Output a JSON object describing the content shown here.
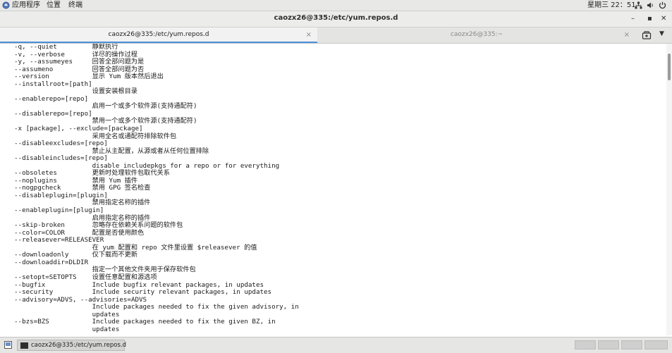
{
  "topbar": {
    "applications": "应用程序",
    "places": "位置",
    "terminal": "终端",
    "datetime": "星期三 22：51"
  },
  "window": {
    "title": "caozx26@335:/etc/yum.repos.d",
    "minimize_glyph": "–",
    "maximize_glyph": "▪",
    "close_glyph": "✕"
  },
  "tabs": [
    {
      "label": "caozx26@335:/etc/yum.repos.d",
      "close": "×",
      "active": true
    },
    {
      "label": "caozx26@335:~",
      "close": "×",
      "active": false
    }
  ],
  "tabbar": {
    "menu_glyph": "▼"
  },
  "terminal": {
    "lines": [
      "-q, --quiet         静默执行",
      "-v, --verbose       详尽的操作过程",
      "-y, --assumeyes     回答全部问题为是",
      "--assumeno          回答全部问题为否",
      "--version           显示 Yum 版本然后退出",
      "--installroot=[path]",
      "                    设置安装根目录",
      "--enablerepo=[repo]",
      "                    启用一个或多个软件源(支持通配符)",
      "--disablerepo=[repo]",
      "                    禁用一个或多个软件源(支持通配符)",
      "-x [package], --exclude=[package]",
      "                    采用全名或通配符排除软件包",
      "--disableexcludes=[repo]",
      "                    禁止从主配置，从源或者从任何位置排除",
      "--disableincludes=[repo]",
      "                    disable includepkgs for a repo or for everything",
      "--obsoletes         更新时处理软件包取代关系",
      "--noplugins         禁用 Yum 插件",
      "--nogpgcheck        禁用 GPG 签名检查",
      "--disableplugin=[plugin]",
      "                    禁用指定名称的插件",
      "--enableplugin=[plugin]",
      "                    启用指定名称的插件",
      "--skip-broken       忽略存在依赖关系问题的软件包",
      "--color=COLOR       配置是否使用颜色",
      "--releasever=RELEASEVER",
      "                    在 yum 配置和 repo 文件里设置 $releasever 的值",
      "--downloadonly      仅下载而不更新",
      "--downloaddir=DLDIR",
      "                    指定一个其他文件夹用于保存软件包",
      "--setopt=SETOPTS    设置任意配置和源选项",
      "--bugfix            Include bugfix relevant packages, in updates",
      "--security          Include security relevant packages, in updates",
      "--advisory=ADVS, --advisories=ADVS",
      "                    Include packages needed to fix the given advisory, in",
      "                    updates",
      "--bzs=BZS           Include packages needed to fix the given BZ, in",
      "                    updates"
    ]
  },
  "taskbar": {
    "task_label": "caozx26@335:/etc/yum.repos.d"
  }
}
